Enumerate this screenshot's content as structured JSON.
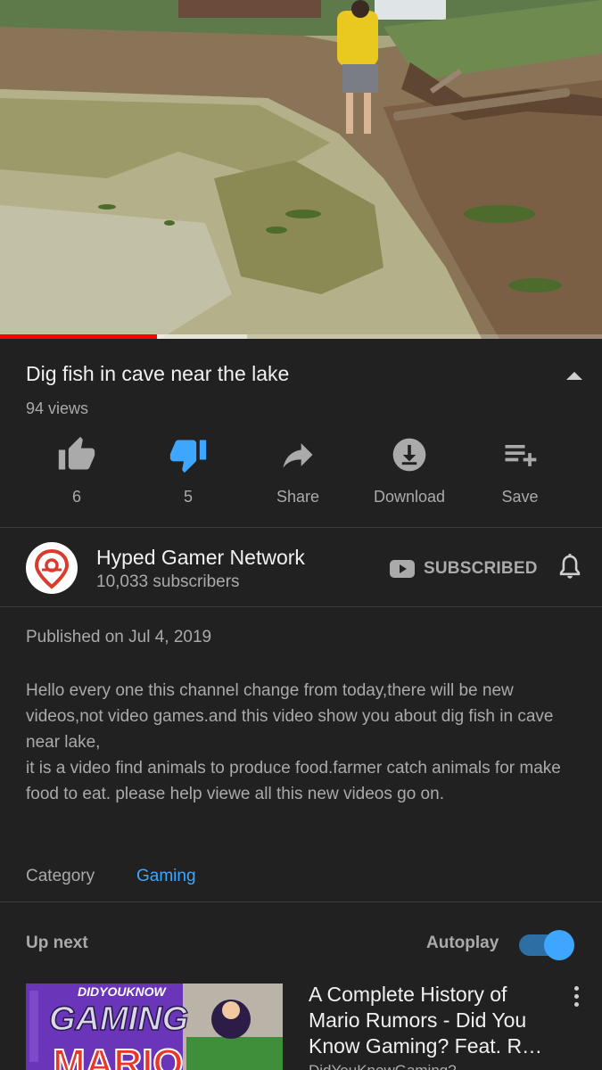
{
  "video": {
    "title": "Dig fish in cave near the lake",
    "views": "94 views",
    "progress_played_fraction": 0.26,
    "progress_buffered_fraction": 0.41
  },
  "actions": {
    "like": {
      "icon": "thumbs-up-icon",
      "label": "6"
    },
    "dislike": {
      "icon": "thumbs-down-icon",
      "label": "5",
      "active": true,
      "color": "#3ea6ff"
    },
    "share": {
      "icon": "share-icon",
      "label": "Share"
    },
    "download": {
      "icon": "download-icon",
      "label": "Download"
    },
    "save": {
      "icon": "playlist-add-icon",
      "label": "Save"
    }
  },
  "channel": {
    "name": "Hyped Gamer Network",
    "subscribers": "10,033 subscribers",
    "subscribed_label": "SUBSCRIBED",
    "avatar_icon": "map-pin-icon"
  },
  "description": {
    "published": "Published on Jul 4, 2019",
    "text": "Hello every one this channel change from today,there will be new videos,not video games.and this video show you about dig fish in cave near lake,\nit is a video find animals to produce food.farmer catch animals for make food to eat. please help viewe all this new videos go on.",
    "category_label": "Category",
    "category_value": "Gaming"
  },
  "up_next": {
    "label": "Up next",
    "autoplay_label": "Autoplay",
    "autoplay_on": true,
    "items": [
      {
        "title": "A Complete History of Mario Rumors - Did You Know Gaming? Feat. R…",
        "channel": "DidYouKnowGaming?",
        "thumb_text_1": "DIDYOUKNOW",
        "thumb_text_2": "GAMING",
        "thumb_text_3": "MARIO"
      }
    ]
  },
  "colors": {
    "background": "#212121",
    "accent_blue": "#3ea6ff",
    "progress_red": "#ff0000",
    "secondary_text": "#aaaaaa"
  }
}
